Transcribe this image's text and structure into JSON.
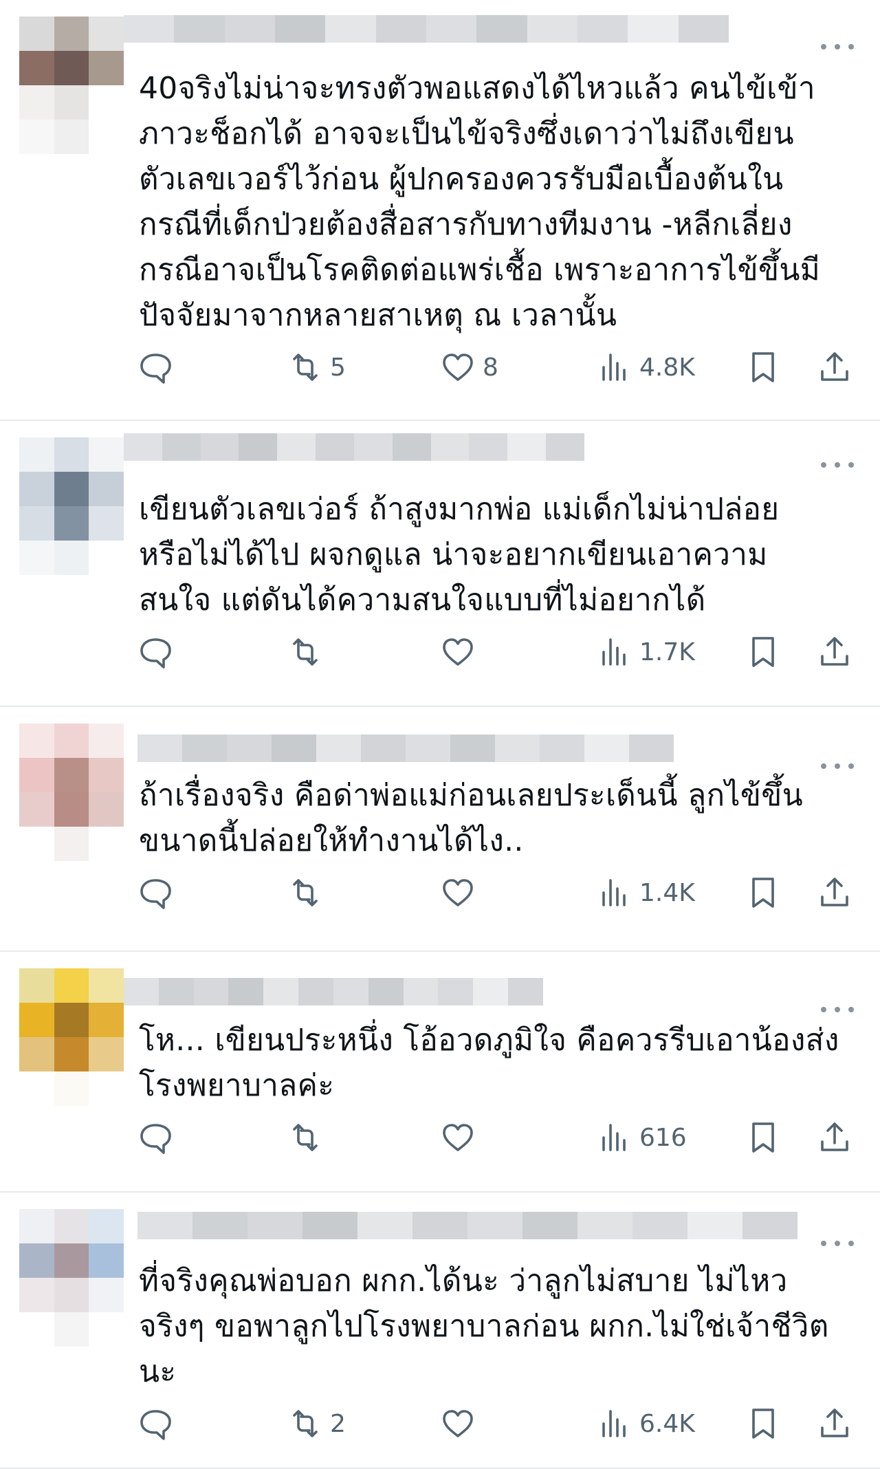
{
  "replies": [
    {
      "text": "40จริงไม่น่าจะทรงตัวพอแสดงได้ไหวแล้ว คนไข้เข้า\nภาวะช็อกได้ อาจจะเป็นไข้จริงซึ่งเดาว่าไม่ถึงเขียน\nตัวเลขเวอร์ไว้ก่อน ผู้ปกครองควรรับมือเบื้องต้นใน\nกรณีที่เด็กป่วยต้องสื่อสารกับทางทีมงาน -หลีกเลี่ยง\nกรณีอาจเป็นโรคติดต่อแพร่เชื้อ เพราะอาการไข้ขึ้นมี\nปัจจัยมาจากหลายสาเหตุ ณ เวลานั้น",
      "retweets": "5",
      "likes": "8",
      "views": "4.8K",
      "avatar_colors": [
        "#d9d9d9",
        "#b5aca6",
        "#e2e2e2",
        "#8b6d63",
        "#6f5a55",
        "#a8998f",
        "#f2f0ef",
        "#e6e4e3",
        "#ffffff",
        "#f7f7f7",
        "#efefef",
        "#ffffff"
      ]
    },
    {
      "text": "เขียนตัวเลขเว่อร์ ถ้าสูงมากพ่อ แม่เด็กไม่น่าปล่อย\nหรือไม่ได้ไป ผจกดูแล น่าจะอยากเขียนเอาความ\nสนใจ แต่ดันได้ความสนใจแบบที่ไม่อยากได้",
      "retweets": "",
      "likes": "",
      "views": "1.7K",
      "avatar_colors": [
        "#eef1f4",
        "#d7dee6",
        "#f2f4f6",
        "#c9d1da",
        "#6f7e8e",
        "#c6ced7",
        "#d6dde4",
        "#8392a2",
        "#dde3e8",
        "#f4f6f8",
        "#eef1f4",
        "#ffffff"
      ]
    },
    {
      "text": "ถ้าเรื่องจริง คือด่าพ่อแม่ก่อนเลยประเด็นนี้ ลูกไข้ขึ้น\nขนาดนี้ปล่อยให้ทำงานได้ไง..",
      "retweets": "",
      "likes": "",
      "views": "1.4K",
      "avatar_colors": [
        "#f7e6e6",
        "#f0d4d4",
        "#f7ecec",
        "#ecc4c4",
        "#b89088",
        "#e8c8c4",
        "#e8cccc",
        "#b88d86",
        "#e0c7c4",
        "#ffffff",
        "#f4f0ef",
        "#ffffff"
      ]
    },
    {
      "text": "โห... เขียนประหนึ่ง โอ้อวดภูมิใจ คือควรรีบเอาน้องส่ง\nโรงพยาบาลค่ะ",
      "retweets": "",
      "likes": "",
      "views": "616",
      "avatar_colors": [
        "#e9dd9c",
        "#f3d24a",
        "#f1e3a0",
        "#e8b426",
        "#a67a25",
        "#e4b035",
        "#e2c27d",
        "#c6892b",
        "#e8cb8a",
        "#ffffff",
        "#fbfaf4",
        "#ffffff"
      ]
    },
    {
      "text": "ที่จริงคุณพ่อบอก ผกก.ได้นะ ว่าลูกไม่สบาย ไม่ไหว\nจริงๆ ขอพาลูกไปโรงพยาบาลก่อน ผกก.ไม่ใช่เจ้าชีวิต\nนะ",
      "retweets": "2",
      "likes": "",
      "views": "6.4K",
      "avatar_colors": [
        "#eff0f3",
        "#e6e3e6",
        "#dbe6f0",
        "#aab5c8",
        "#a9999e",
        "#a9c0dc",
        "#ede7ea",
        "#e6dfe1",
        "#f0f2f5",
        "#ffffff",
        "#f5f4f4",
        "#ffffff"
      ]
    }
  ]
}
